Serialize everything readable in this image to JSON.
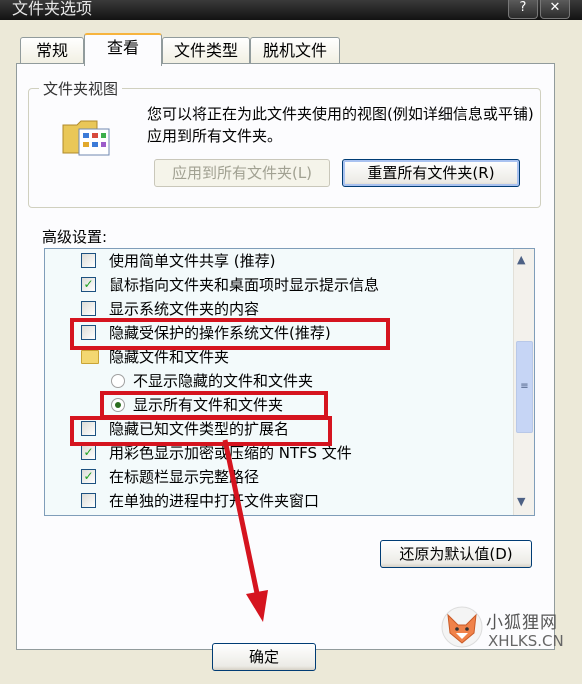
{
  "window": {
    "title": "文件夹选项",
    "help_label": "?",
    "close_label": "✕"
  },
  "tabs": [
    {
      "label": "常规"
    },
    {
      "label": "查看"
    },
    {
      "label": "文件类型"
    },
    {
      "label": "脱机文件"
    }
  ],
  "folder_views": {
    "title": "文件夹视图",
    "description": "您可以将正在为此文件夹使用的视图(例如详细信息或平铺)应用到所有文件夹。",
    "apply_all_label": "应用到所有文件夹(L)",
    "reset_all_label": "重置所有文件夹(R)"
  },
  "advanced": {
    "label": "高级设置:",
    "items": [
      {
        "type": "checkbox",
        "checked": false,
        "label": "使用简单文件共享 (推荐)"
      },
      {
        "type": "checkbox",
        "checked": true,
        "label": "鼠标指向文件夹和桌面项时显示提示信息"
      },
      {
        "type": "checkbox",
        "checked": false,
        "label": "显示系统文件夹的内容"
      },
      {
        "type": "checkbox",
        "checked": false,
        "label": "隐藏受保护的操作系统文件(推荐)"
      },
      {
        "type": "folder",
        "label": "隐藏文件和文件夹"
      },
      {
        "type": "radio",
        "checked": false,
        "label": "不显示隐藏的文件和文件夹"
      },
      {
        "type": "radio",
        "checked": true,
        "label": "显示所有文件和文件夹"
      },
      {
        "type": "checkbox",
        "checked": false,
        "label": "隐藏已知文件类型的扩展名"
      },
      {
        "type": "checkbox",
        "checked": true,
        "label": "用彩色显示加密或压缩的 NTFS 文件"
      },
      {
        "type": "checkbox",
        "checked": true,
        "label": "在标题栏显示完整路径"
      },
      {
        "type": "checkbox",
        "checked": false,
        "label": "在单独的进程中打开文件夹窗口"
      }
    ],
    "restore_defaults_label": "还原为默认值(D)"
  },
  "footer": {
    "ok_label": "确定"
  },
  "watermark": {
    "brand": "小狐狸网",
    "domain": "XHLKS.CN"
  },
  "colors": {
    "highlight": "#d5141f",
    "accent_tab": "#f7b43e"
  }
}
